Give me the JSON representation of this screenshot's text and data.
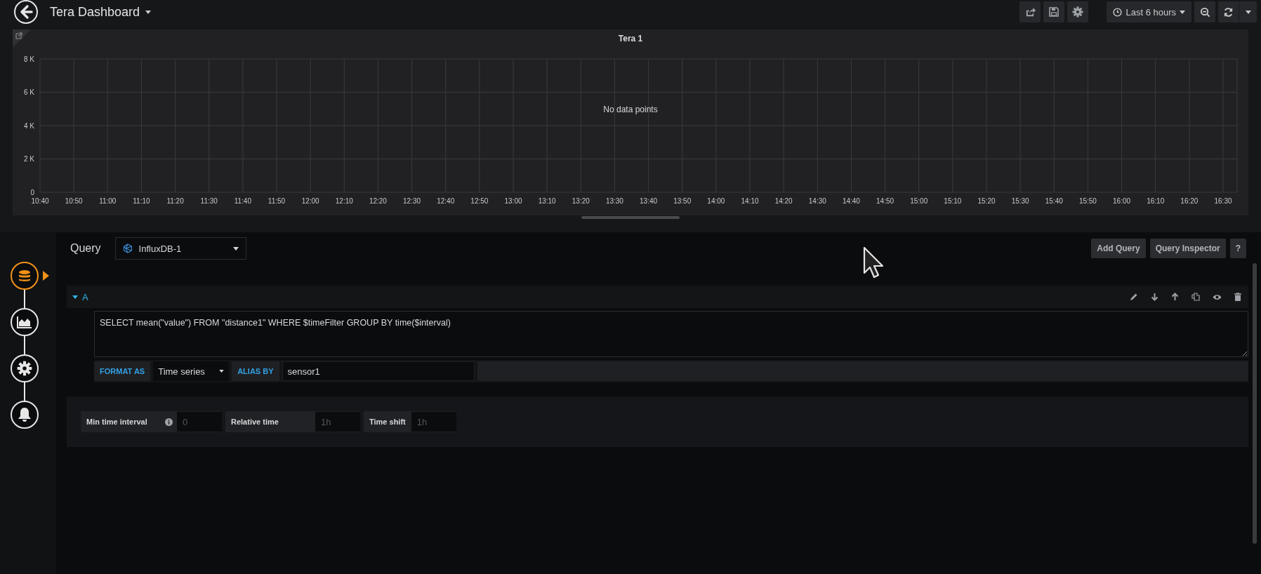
{
  "header": {
    "title": "Tera Dashboard",
    "time_range": "Last 6 hours"
  },
  "panel": {
    "message": "No data points",
    "chart_data": {
      "type": "line",
      "title": "Tera 1",
      "grid": true,
      "categories": [
        "10:40",
        "10:50",
        "11:00",
        "11:10",
        "11:20",
        "11:30",
        "11:40",
        "11:50",
        "12:00",
        "12:10",
        "12:20",
        "12:30",
        "12:40",
        "12:50",
        "13:00",
        "13:10",
        "13:20",
        "13:30",
        "13:40",
        "13:50",
        "14:00",
        "14:10",
        "14:20",
        "14:30",
        "14:40",
        "14:50",
        "15:00",
        "15:10",
        "15:20",
        "15:30",
        "15:40",
        "15:50",
        "16:00",
        "16:10",
        "16:20",
        "16:30"
      ],
      "ylim": [
        0,
        8000
      ],
      "yticks": [
        {
          "value": 0,
          "label": "0"
        },
        {
          "value": 2000,
          "label": "2 K"
        },
        {
          "value": 4000,
          "label": "4 K"
        },
        {
          "value": 6000,
          "label": "6 K"
        },
        {
          "value": 8000,
          "label": "8 K"
        }
      ]
    }
  },
  "query": {
    "label": "Query",
    "datasource": "InfluxDB-1",
    "buttons": [
      "Add Query",
      "Query Inspector",
      "?"
    ],
    "rail": [
      {
        "kind": "queries",
        "selected": true
      },
      {
        "kind": "visualization",
        "selected": false
      },
      {
        "kind": "general",
        "selected": false
      },
      {
        "kind": "alert",
        "selected": false
      }
    ],
    "queries": [
      {
        "letter": "A",
        "expanded": true,
        "text": "SELECT mean(\"value\") FROM \"distance1\" WHERE $timeFilter GROUP BY time($interval)",
        "format_label": "FORMAT AS",
        "format": "Time series",
        "alias_label": "ALIAS BY",
        "alias": "sensor1"
      }
    ],
    "options": [
      {
        "label": "Min time interval",
        "info": true,
        "placeholder": "0"
      },
      {
        "label": "Relative time",
        "info": false,
        "placeholder": "1h"
      },
      {
        "label": "Time shift",
        "info": false,
        "placeholder": "1h"
      }
    ]
  }
}
